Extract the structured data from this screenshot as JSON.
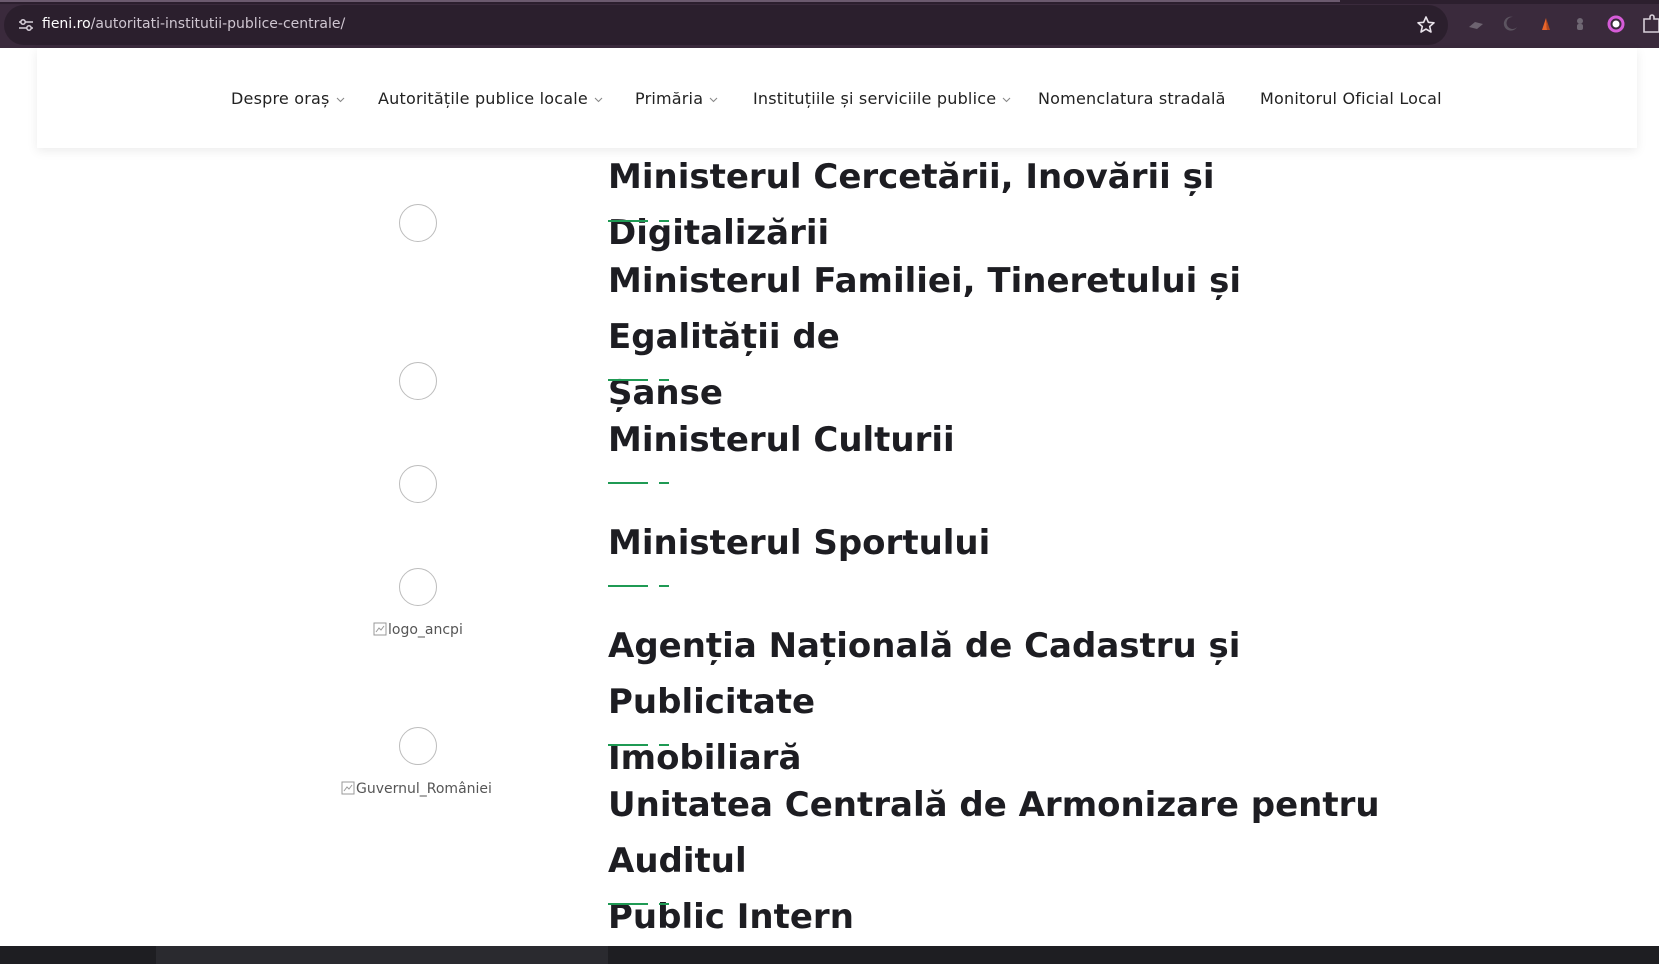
{
  "browser": {
    "url_host": "fieni.ro",
    "url_path": "/autoritati-institutii-publice-centrale/"
  },
  "nav": {
    "items": [
      {
        "label": "Despre oraș",
        "dropdown": true
      },
      {
        "label": "Autoritățile publice locale",
        "dropdown": true
      },
      {
        "label": "Primăria",
        "dropdown": true
      },
      {
        "label": "Instituțiile și serviciile publice",
        "dropdown": true
      },
      {
        "label": "Nomenclatura stradală",
        "dropdown": false
      },
      {
        "label": "Monitorul Oficial Local",
        "dropdown": false
      }
    ]
  },
  "entries": [
    {
      "title_line1": "Ministerul Cercetării, Inovării și Digitalizării",
      "title_line2": ""
    },
    {
      "title_line1": "Ministerul Familiei, Tineretului și Egalității de",
      "title_line2": "Șanse"
    },
    {
      "title_line1": "Ministerul Culturii",
      "title_line2": ""
    },
    {
      "title_line1": "Ministerul Sportului",
      "title_line2": ""
    },
    {
      "title_line1": "Agenția Națională de Cadastru și Publicitate",
      "title_line2": "Imobiliară"
    },
    {
      "title_line1": "Unitatea Centrală de Armonizare pentru Auditul",
      "title_line2": "Public Intern"
    }
  ],
  "broken_images": {
    "ancpi_alt": "logo_ancpi",
    "gov_alt": "Guvernul_României"
  },
  "colors": {
    "accent_green": "#1f9a54",
    "browser_bg": "#3a2a3c",
    "title_text": "#1d1d22"
  }
}
